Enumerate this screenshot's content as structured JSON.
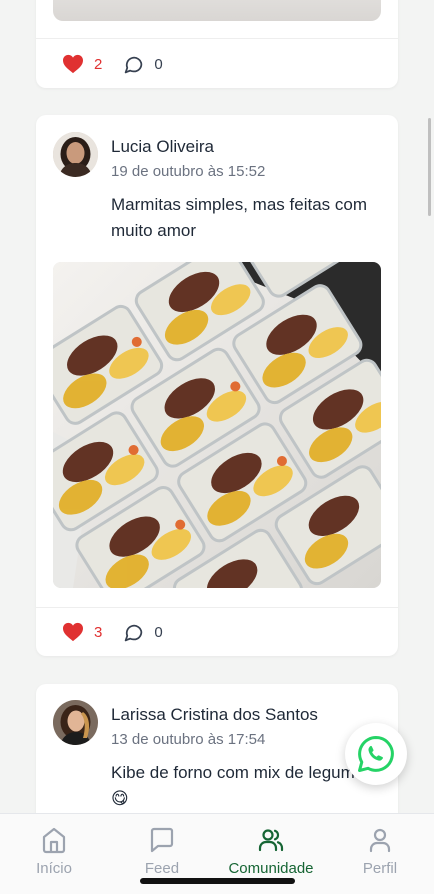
{
  "posts": [
    {
      "likes": "2",
      "comments": "0"
    },
    {
      "author": "Lucia Oliveira",
      "time": "19 de outubro às 15:52",
      "text": "Marmitas simples, mas feitas com muito amor",
      "likes": "3",
      "comments": "0"
    },
    {
      "author": "Larissa Cristina dos Santos",
      "time": "13 de outubro às 17:54",
      "text": "Kibe de forno com mix de legumes 😋"
    }
  ],
  "tabs": [
    {
      "label": "Início",
      "icon": "home-icon",
      "active": false
    },
    {
      "label": "Feed",
      "icon": "message-square-icon",
      "active": false
    },
    {
      "label": "Comunidade",
      "icon": "users-icon",
      "active": true
    },
    {
      "label": "Perfil",
      "icon": "user-icon",
      "active": false
    }
  ],
  "colors": {
    "accent": "#166534",
    "like": "#e03131",
    "whatsapp": "#25d366",
    "inactive": "#9ca3af",
    "background": "#f3f4f3"
  }
}
